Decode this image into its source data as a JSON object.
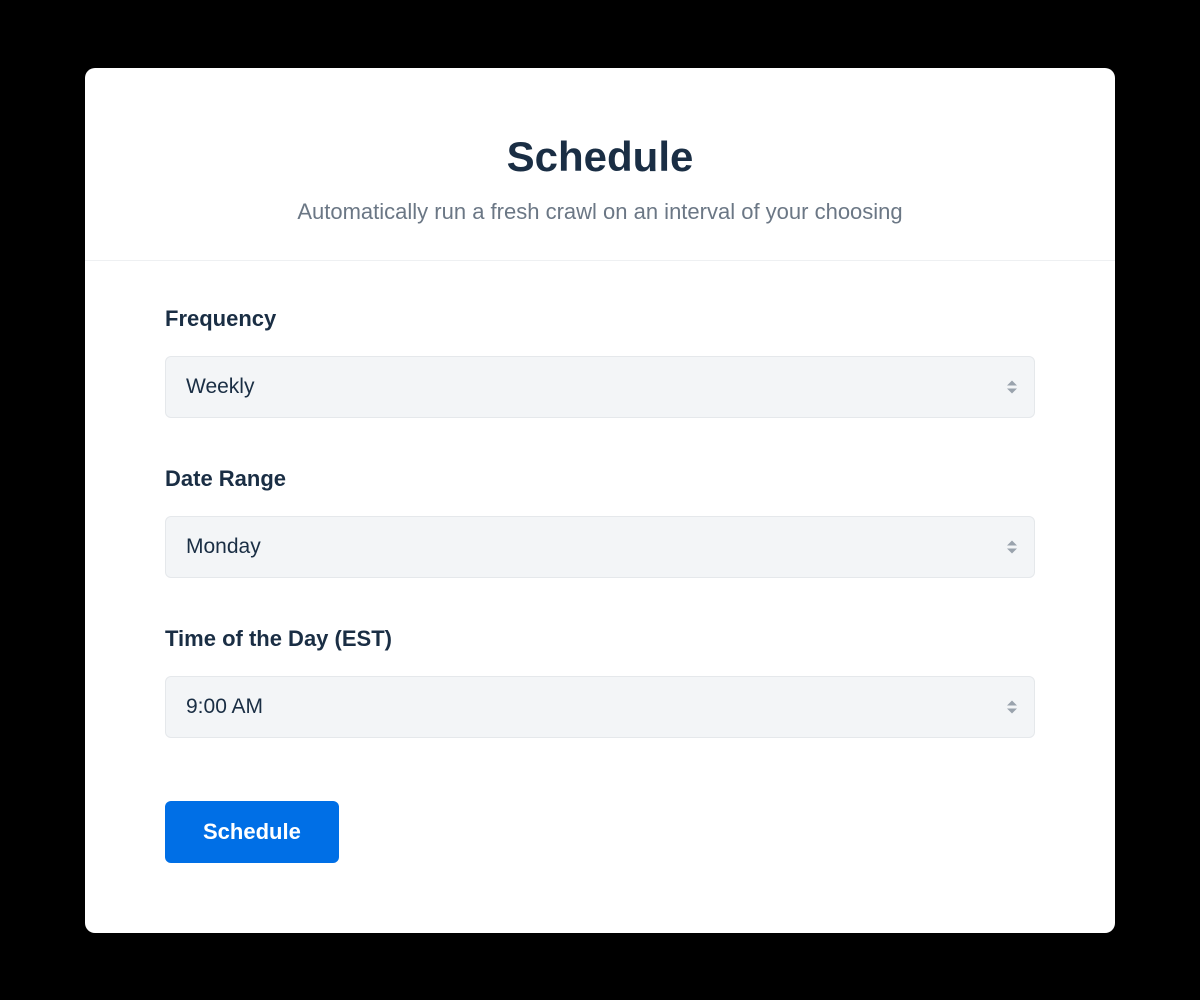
{
  "header": {
    "title": "Schedule",
    "subtitle": "Automatically run a fresh crawl on an interval of your choosing"
  },
  "form": {
    "frequency": {
      "label": "Frequency",
      "value": "Weekly"
    },
    "date_range": {
      "label": "Date Range",
      "value": "Monday"
    },
    "time_of_day": {
      "label": "Time of the Day (EST)",
      "value": "9:00 AM"
    },
    "submit_label": "Schedule"
  }
}
